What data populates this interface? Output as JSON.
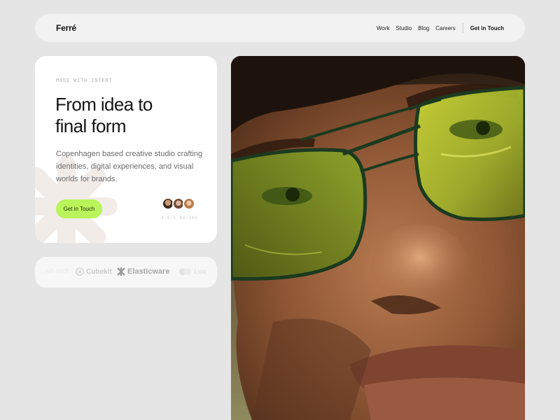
{
  "nav": {
    "brand": "Ferré",
    "links": [
      "Work",
      "Studio",
      "Blog",
      "Careers"
    ],
    "cta": "Get in Touch"
  },
  "hero": {
    "eyebrow": "MADE WITH INTENT",
    "headline_line1": "From idea to",
    "headline_line2": "final form",
    "description": "Copenhagen based creative studio crafting identities, digital experiences, and visual worlds for brands.",
    "cta": "Get in Touch",
    "rating": "4.9/5 RATING"
  },
  "logos": [
    {
      "name": "Alt-shift",
      "icon": "altshift-icon"
    },
    {
      "name": "Cubekit",
      "icon": "cube-icon"
    },
    {
      "name": "Elasticware",
      "icon": "asterisk-icon"
    },
    {
      "name": "Lux",
      "icon": "circles-icon"
    }
  ],
  "colors": {
    "background": "#e5e5e5",
    "accent": "#b9f45a",
    "card": "#ffffff"
  },
  "portrait": {
    "icon": "portrait-photo"
  }
}
